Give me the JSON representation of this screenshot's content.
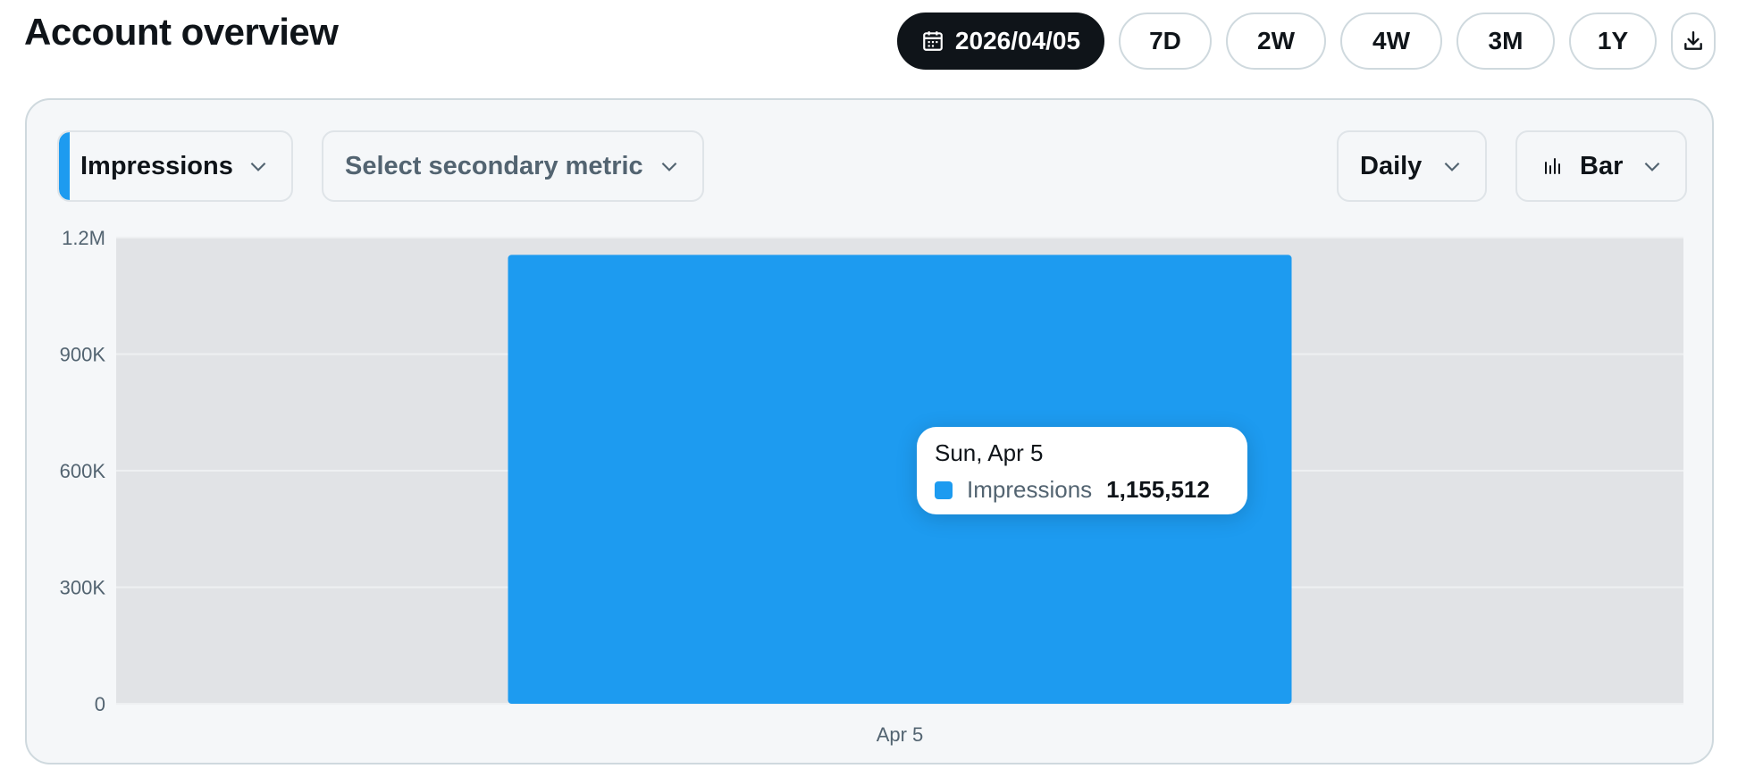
{
  "header": {
    "title": "Account overview"
  },
  "range": {
    "date_label": "2026/04/05",
    "date_icon": "calendar-icon",
    "options": [
      "7D",
      "2W",
      "4W",
      "3M",
      "1Y"
    ],
    "download_icon": "download-icon"
  },
  "controls": {
    "primary_metric": "Impressions",
    "secondary_metric_placeholder": "Select secondary metric",
    "interval": "Daily",
    "chart_type": "Bar",
    "chart_type_icon": "bar-chart-icon",
    "chevron_icon": "chevron-down-icon"
  },
  "tooltip": {
    "date": "Sun, Apr 5",
    "metric": "Impressions",
    "value": "1,155,512"
  },
  "colors": {
    "accent": "#1d9bf0",
    "plot_background": "#e1e3e6",
    "dark_button": "#0f1419"
  },
  "chart_data": {
    "type": "bar",
    "categories": [
      "Apr 5"
    ],
    "values": [
      1155512
    ],
    "ylim": [
      0,
      1200000
    ],
    "yticks": [
      0,
      300000,
      600000,
      900000,
      1200000
    ],
    "ytick_labels": [
      "0",
      "300K",
      "600K",
      "900K",
      "1.2M"
    ],
    "grid": true,
    "color": "#1d9bf0"
  }
}
